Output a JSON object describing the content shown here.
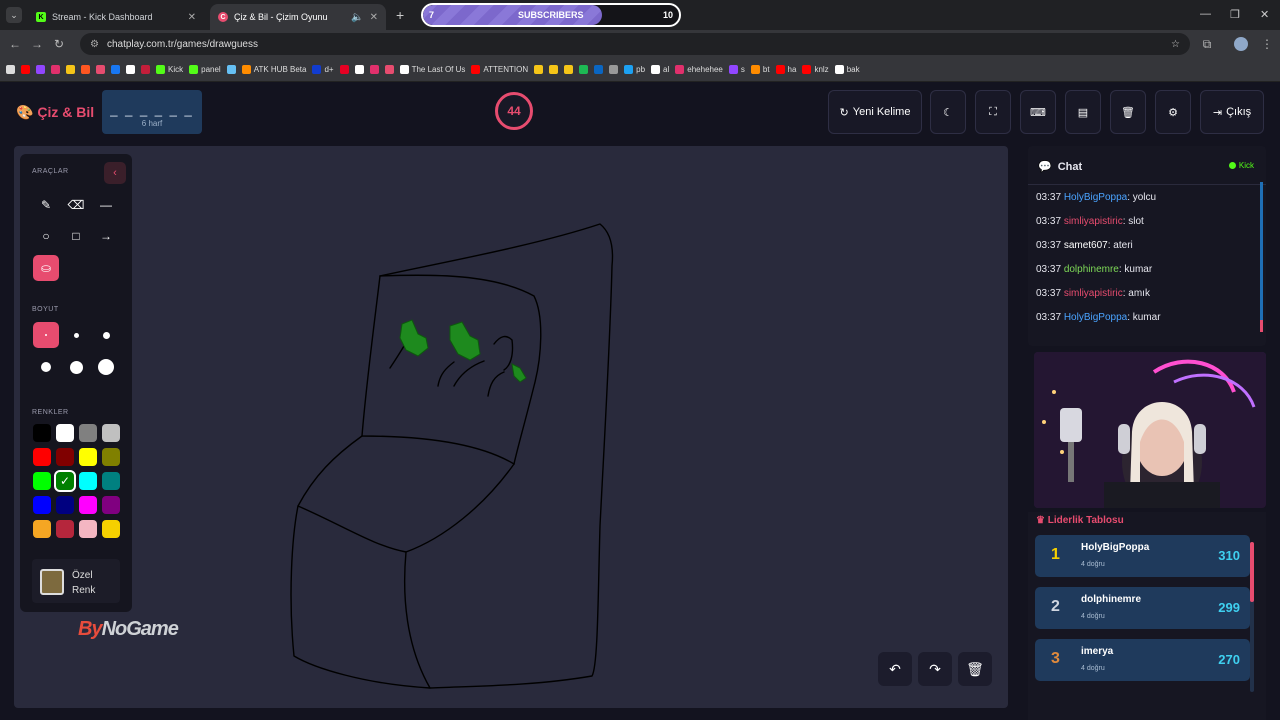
{
  "browser": {
    "tabs": [
      {
        "title": "Stream - Kick Dashboard",
        "favicon": "kick-icon",
        "color": "#53fc18"
      },
      {
        "title": "Çiz & Bil - Çizim Oyunu",
        "favicon": "chatplay-icon",
        "color": "#e74c6f"
      }
    ],
    "subscribers": {
      "label": "SUBSCRIBERS",
      "current": "7",
      "goal": "10",
      "progress": 0.7
    },
    "url": "chatplay.com.tr/games/drawguess",
    "bookmarks": [
      {
        "label": "",
        "color": "#ff0000"
      },
      {
        "label": "",
        "color": "#9146ff"
      },
      {
        "label": "",
        "color": "#e1306c"
      },
      {
        "label": "",
        "color": "#f5c518"
      },
      {
        "label": "",
        "color": "#ff5722"
      },
      {
        "label": "",
        "color": "#e74c6f"
      },
      {
        "label": "",
        "color": "#1877f2"
      },
      {
        "label": "",
        "color": "#ffffff"
      },
      {
        "label": "",
        "color": "#c41e3a"
      },
      {
        "label": "Kick",
        "color": "#53fc18"
      },
      {
        "label": "panel",
        "color": "#53fc18"
      },
      {
        "label": "",
        "color": "#66c0f4"
      },
      {
        "label": "ATK HUB Beta",
        "color": "#ff8c00"
      },
      {
        "label": "d+",
        "color": "#113ccf"
      },
      {
        "label": "",
        "color": "#e60023"
      },
      {
        "label": "",
        "color": "#ffffff"
      },
      {
        "label": "",
        "color": "#e1306c"
      },
      {
        "label": "",
        "color": "#e74c6f"
      },
      {
        "label": "The Last Of Us",
        "color": "#ffffff"
      },
      {
        "label": "ATTENTION",
        "color": "#ff0000"
      },
      {
        "label": "",
        "color": "#f5c518"
      },
      {
        "label": "",
        "color": "#f5c518"
      },
      {
        "label": "",
        "color": "#f5c518"
      },
      {
        "label": "",
        "color": "#1db954"
      },
      {
        "label": "",
        "color": "#0a66c2"
      },
      {
        "label": "",
        "color": "#999999"
      },
      {
        "label": "pb",
        "color": "#1da1f2"
      },
      {
        "label": "al",
        "color": "#ffffff"
      },
      {
        "label": "ehehehee",
        "color": "#e1306c"
      },
      {
        "label": "s",
        "color": "#9146ff"
      },
      {
        "label": "bt",
        "color": "#ff8c00"
      },
      {
        "label": "ha",
        "color": "#ff0000"
      },
      {
        "label": "knlz",
        "color": "#ff0000"
      },
      {
        "label": "bak",
        "color": "#ffffff"
      }
    ]
  },
  "header": {
    "logo": "Çiz & Bil",
    "word": "_ _ _ _ _ _",
    "word_hint": "6 harf",
    "timer": "44",
    "new_word": "Yeni Kelime",
    "exit": "Çıkış"
  },
  "tools": {
    "title_tools": "ARAÇLAR",
    "title_size": "BOYUT",
    "title_colors": "RENKLER",
    "custom_color": "Özel Renk",
    "custom_color_line1": "Özel",
    "custom_color_line2": "Renk",
    "colors": [
      "#000000",
      "#ffffff",
      "#808080",
      "#c0c0c0",
      "#ff0000",
      "#800000",
      "#ffff00",
      "#808000",
      "#00ff00",
      "#008000",
      "#00ffff",
      "#008080",
      "#0000ff",
      "#000080",
      "#ff00ff",
      "#800080",
      "#f5a623",
      "#b5263c",
      "#f4b6c2",
      "#f5d000"
    ],
    "selected_color": "#008000"
  },
  "watermark": {
    "prefix": "By",
    "rest": "NoGame"
  },
  "chat": {
    "title": "Chat",
    "platform": "Kick",
    "messages": [
      {
        "time": "03:37",
        "user": "HolyBigPoppa",
        "color": "#4aa3ff",
        "text": "yolcu"
      },
      {
        "time": "03:37",
        "user": "simliyapistiric",
        "color": "#e74c6f",
        "text": "slot"
      },
      {
        "time": "03:37",
        "user": "samet607",
        "color": "#ffffff",
        "text": "ateri"
      },
      {
        "time": "03:37",
        "user": "dolphinemre",
        "color": "#7ed957",
        "text": "kumar"
      },
      {
        "time": "03:37",
        "user": "simliyapistiric",
        "color": "#e74c6f",
        "text": "amık"
      },
      {
        "time": "03:37",
        "user": "HolyBigPoppa",
        "color": "#4aa3ff",
        "text": "kumar"
      }
    ]
  },
  "leaderboard": {
    "title": "Liderlik Tablosu",
    "rows": [
      {
        "rank": "1",
        "name": "HolyBigPoppa",
        "sub": "4 doğru",
        "points": "310",
        "rank_color": "#f5d000"
      },
      {
        "rank": "2",
        "name": "dolphinemre",
        "sub": "4 doğru",
        "points": "299",
        "rank_color": "#d0d6e0"
      },
      {
        "rank": "3",
        "name": "imerya",
        "sub": "4 doğru",
        "points": "270",
        "rank_color": "#e08a3c"
      }
    ]
  }
}
